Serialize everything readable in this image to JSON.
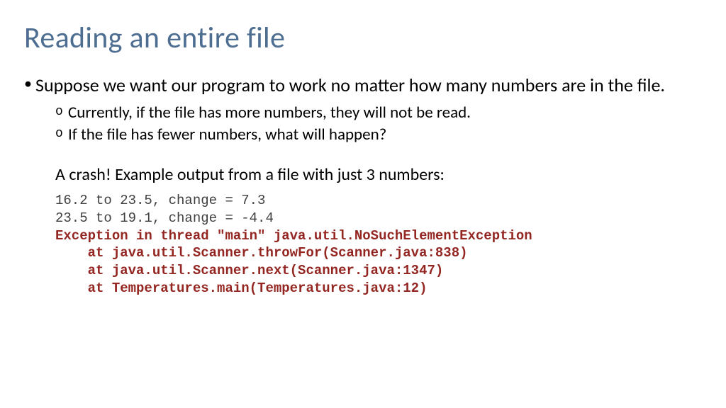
{
  "title": "Reading an entire file",
  "mainBullet": "Suppose we want our program to work no matter how many numbers are in the file.",
  "sub1": "Currently, if the file has more numbers, they will not be read.",
  "sub2": "If the file has fewer numbers, what will happen?",
  "crashLine": "A crash!  Example output from a file with just 3 numbers:",
  "code": {
    "line1": "16.2 to 23.5, change = 7.3",
    "line2": "23.5 to 19.1, change = -4.4",
    "err1": "Exception in thread \"main\" java.util.NoSuchElementException",
    "err2": "    at java.util.Scanner.throwFor(Scanner.java:838)",
    "err3": "    at java.util.Scanner.next(Scanner.java:1347)",
    "err4": "    at Temperatures.main(Temperatures.java:12)"
  }
}
